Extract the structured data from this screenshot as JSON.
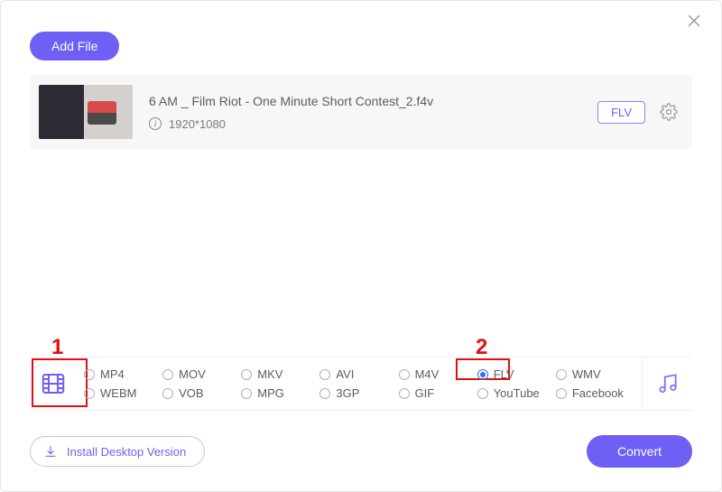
{
  "header": {
    "add_file_label": "Add File"
  },
  "file": {
    "title": "6 AM _ Film Riot - One Minute Short Contest_2.f4v",
    "resolution": "1920*1080",
    "format_badge": "FLV"
  },
  "annotations": {
    "label_1": "1",
    "label_2": "2"
  },
  "formats": {
    "row1": [
      {
        "label": "MP4",
        "selected": false
      },
      {
        "label": "MOV",
        "selected": false
      },
      {
        "label": "MKV",
        "selected": false
      },
      {
        "label": "AVI",
        "selected": false
      },
      {
        "label": "M4V",
        "selected": false
      },
      {
        "label": "FLV",
        "selected": true
      },
      {
        "label": "WMV",
        "selected": false
      }
    ],
    "row2": [
      {
        "label": "WEBM",
        "selected": false
      },
      {
        "label": "VOB",
        "selected": false
      },
      {
        "label": "MPG",
        "selected": false
      },
      {
        "label": "3GP",
        "selected": false
      },
      {
        "label": "GIF",
        "selected": false
      },
      {
        "label": "YouTube",
        "selected": false
      },
      {
        "label": "Facebook",
        "selected": false
      }
    ]
  },
  "footer": {
    "install_label": "Install Desktop Version",
    "convert_label": "Convert"
  }
}
